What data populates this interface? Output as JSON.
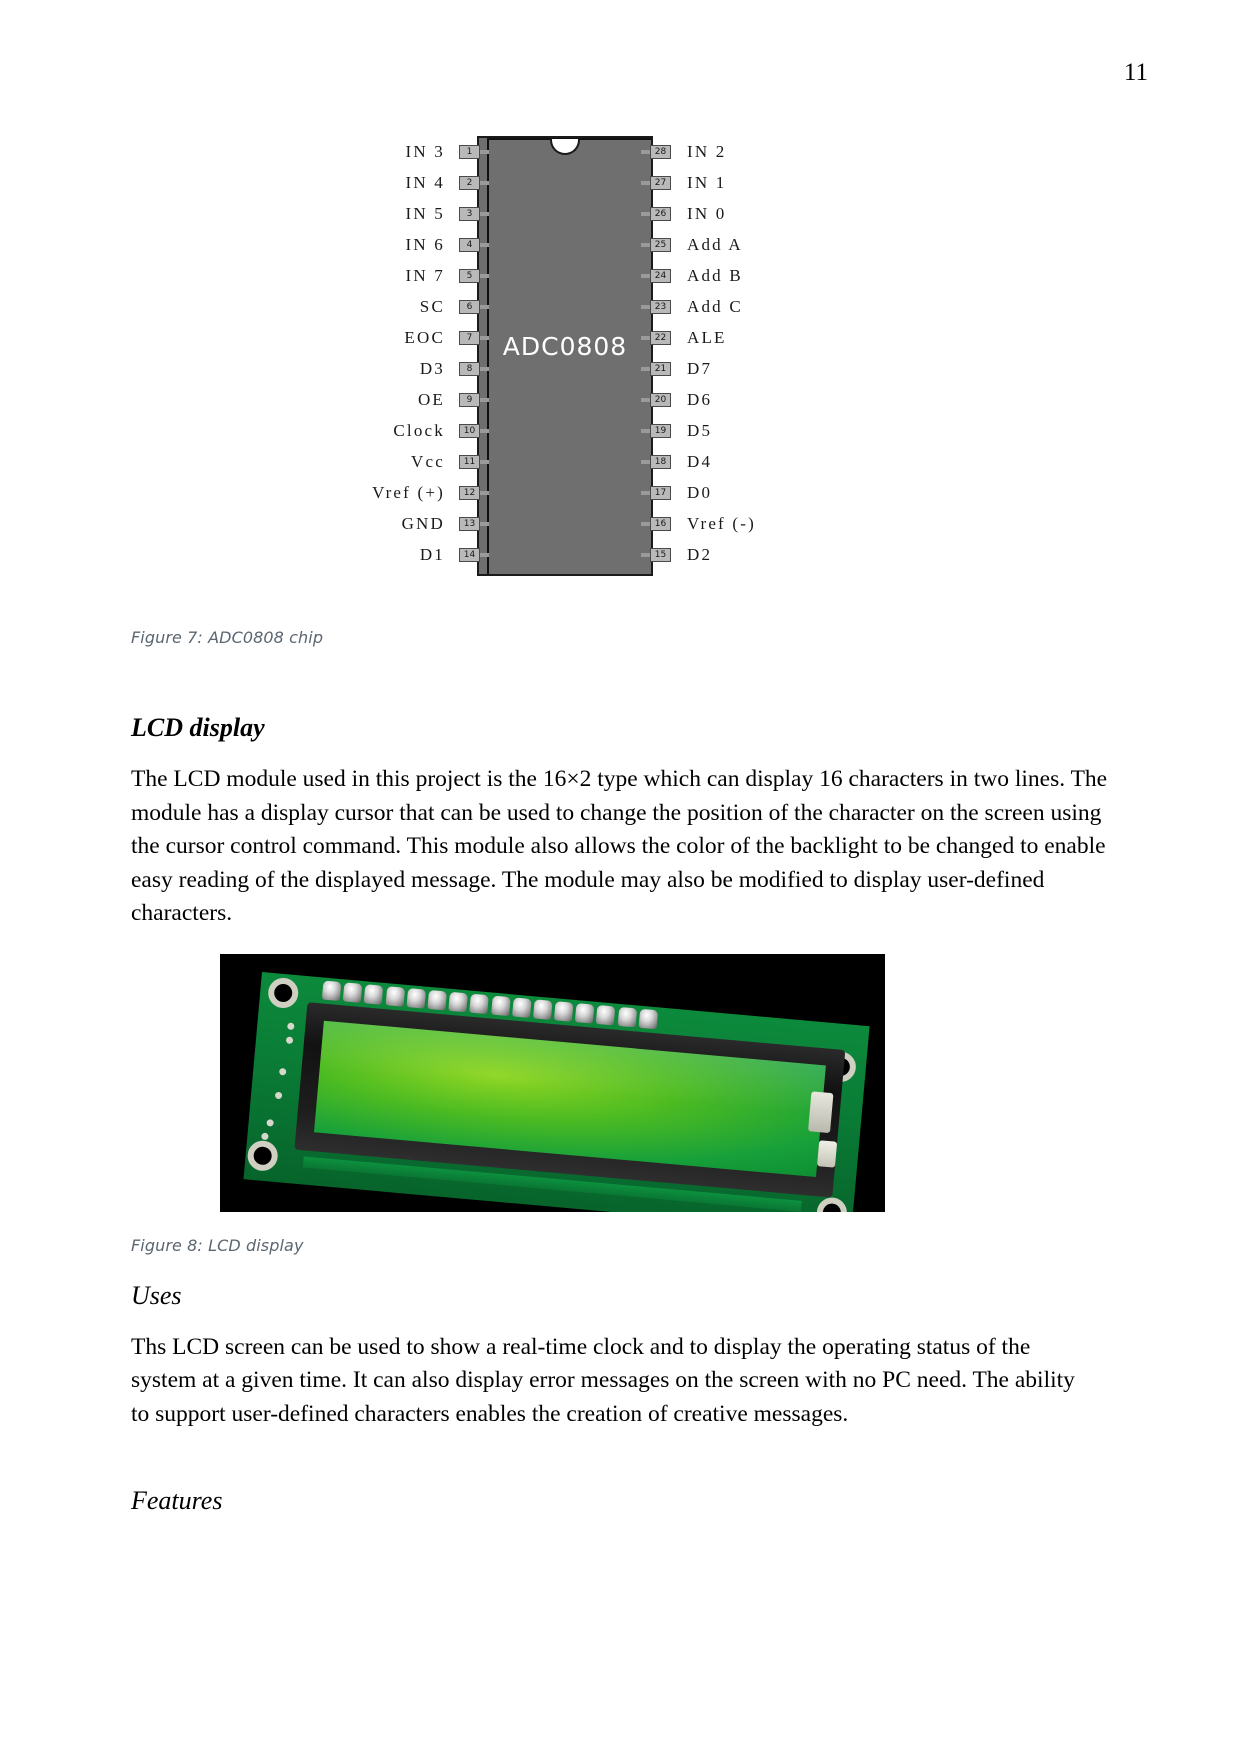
{
  "document": {
    "page_number": "11"
  },
  "figure7": {
    "chip_label": "ADC0808",
    "caption": "Figure 7: ADC0808 chip",
    "left_pins": [
      {
        "num": "1",
        "name": "IN 3"
      },
      {
        "num": "2",
        "name": "IN 4"
      },
      {
        "num": "3",
        "name": "IN 5"
      },
      {
        "num": "4",
        "name": "IN 6"
      },
      {
        "num": "5",
        "name": "IN 7"
      },
      {
        "num": "6",
        "name": "SC"
      },
      {
        "num": "7",
        "name": "EOC"
      },
      {
        "num": "8",
        "name": "D3"
      },
      {
        "num": "9",
        "name": "OE"
      },
      {
        "num": "10",
        "name": "Clock"
      },
      {
        "num": "11",
        "name": "Vcc"
      },
      {
        "num": "12",
        "name": "Vref (+)"
      },
      {
        "num": "13",
        "name": "GND"
      },
      {
        "num": "14",
        "name": "D1"
      }
    ],
    "right_pins": [
      {
        "num": "28",
        "name": "IN 2"
      },
      {
        "num": "27",
        "name": "IN 1"
      },
      {
        "num": "26",
        "name": "IN 0"
      },
      {
        "num": "25",
        "name": "Add A"
      },
      {
        "num": "24",
        "name": "Add B"
      },
      {
        "num": "23",
        "name": "Add C"
      },
      {
        "num": "22",
        "name": "ALE"
      },
      {
        "num": "21",
        "name": "D7"
      },
      {
        "num": "20",
        "name": "D6"
      },
      {
        "num": "19",
        "name": "D5"
      },
      {
        "num": "18",
        "name": "D4"
      },
      {
        "num": "17",
        "name": "D0"
      },
      {
        "num": "16",
        "name": "Vref (-)"
      },
      {
        "num": "15",
        "name": "D2"
      }
    ]
  },
  "sections": {
    "lcd_display": {
      "heading": "LCD display",
      "paragraph": "The LCD module used in this project is the 16×2 type which can display 16 characters in two lines. The module has a display cursor that can be used to change the position of the character on the screen using the cursor control command. This module also allows the color of the backlight to be changed to enable easy reading of the displayed message. The module may also be modified to display user-defined characters."
    },
    "uses": {
      "heading": "Uses",
      "paragraph": "Ths LCD screen can be used to show a real-time clock and to display the operating status of the system at a given time. It can also display error messages on the screen with no PC need. The ability to support user-defined characters enables the creation of creative messages."
    },
    "features": {
      "heading": "Features"
    }
  },
  "figure8": {
    "caption": "Figure 8: LCD display",
    "alt": "photo of a 16x2 green backlit LCD module on a green PCB"
  }
}
